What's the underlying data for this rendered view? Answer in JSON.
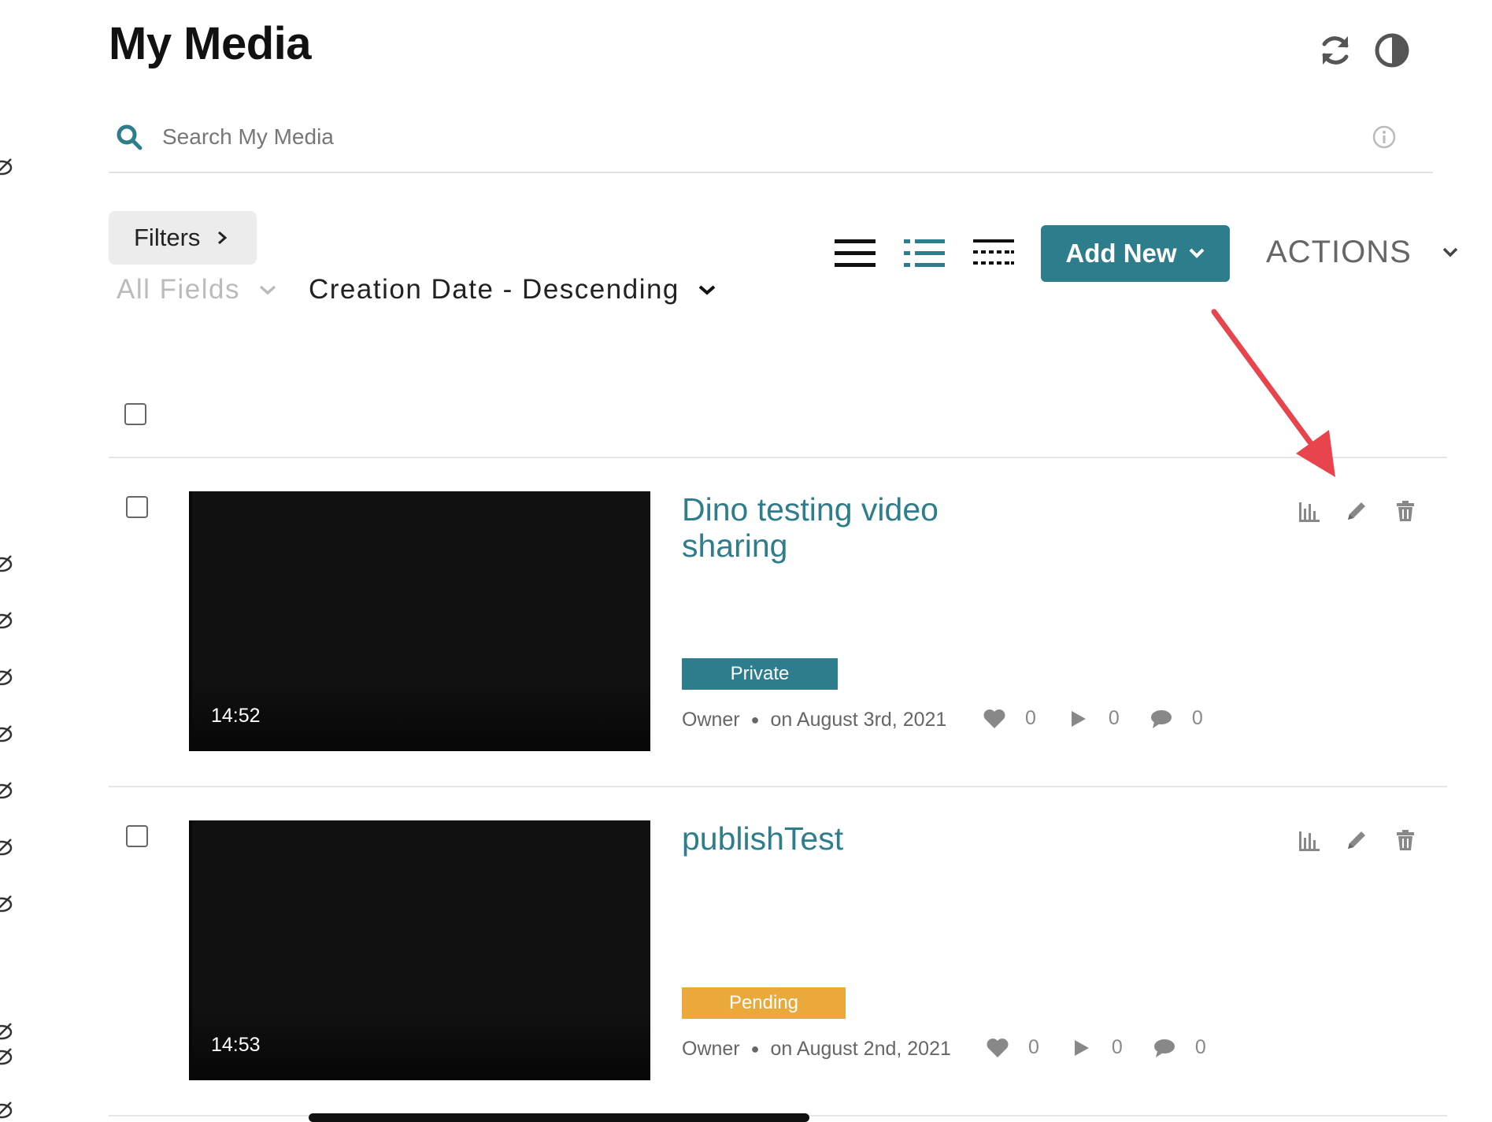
{
  "page": {
    "title": "My Media"
  },
  "header_icons": {
    "refresh": "refresh-icon",
    "contrast": "contrast-icon"
  },
  "search": {
    "placeholder": "Search My Media",
    "value": ""
  },
  "toolbar": {
    "filters_label": "Filters",
    "fields_select": "All Fields",
    "sort_select": "Creation Date - Descending",
    "add_new_label": "Add New",
    "actions_label": "ACTIONS",
    "accent_color": "#2e7d8c"
  },
  "entries": [
    {
      "title": "Dino testing video sharing",
      "duration": "14:52",
      "status": "Private",
      "status_color": "#2e7d8c",
      "role": "Owner",
      "date": "on August 3rd, 2021",
      "likes": "0",
      "plays": "0",
      "comments": "0"
    },
    {
      "title": "publishTest",
      "duration": "14:53",
      "status": "Pending",
      "status_color": "#eba93c",
      "role": "Owner",
      "date": "on August 2nd, 2021",
      "likes": "0",
      "plays": "0",
      "comments": "0"
    }
  ],
  "annotation": {
    "arrow_color": "#e8444e"
  }
}
